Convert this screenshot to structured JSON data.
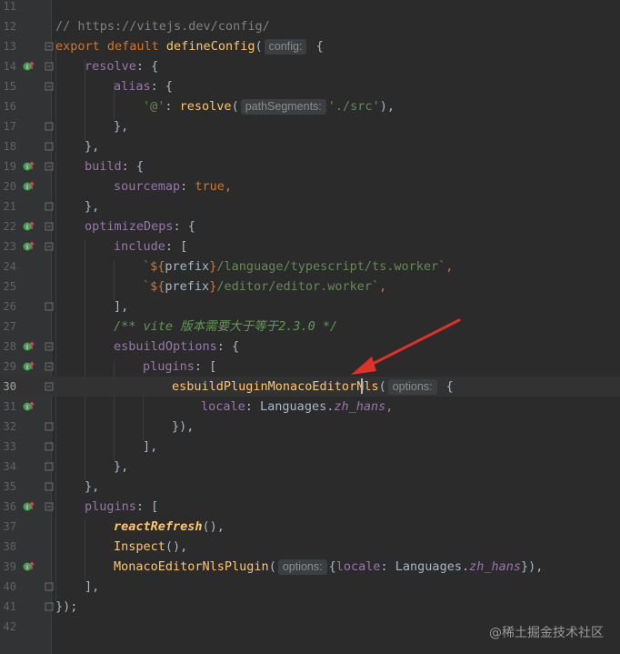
{
  "editor": {
    "line_numbers": [
      "11",
      "12",
      "13",
      "14",
      "15",
      "16",
      "17",
      "18",
      "19",
      "20",
      "21",
      "22",
      "23",
      "24",
      "25",
      "26",
      "27",
      "28",
      "29",
      "30",
      "31",
      "32",
      "33",
      "34",
      "35",
      "36",
      "37",
      "38",
      "39",
      "40",
      "41",
      "42"
    ],
    "current_line": "30",
    "hints": {
      "config": "config:",
      "path_segments": "pathSegments:",
      "options": "options:"
    },
    "code": {
      "l12_comment": "// https://vitejs.dev/config/",
      "l13_export": "export default ",
      "l13_fn": "defineConfig",
      "l13_open": "(",
      "l13_brace": " {",
      "l14_key": "resolve",
      "l14_rest": ": {",
      "l15_key": "alias",
      "l15_rest": ": {",
      "l16_key": "'@'",
      "l16_colon": ": ",
      "l16_fn": "resolve",
      "l16_open": "(",
      "l16_str": "'./src'",
      "l16_close": "),",
      "l17": "},",
      "l18": "},",
      "l19_key": "build",
      "l19_rest": ": {",
      "l20_key": "sourcemap",
      "l20_colon": ": ",
      "l20_val": "true",
      "l20_comma": ",",
      "l21": "},",
      "l22_key": "optimizeDeps",
      "l22_rest": ": {",
      "l23_key": "include",
      "l23_rest": ": [",
      "l24_tick": "`",
      "l24_dollar": "${",
      "l24_var": "prefix",
      "l24_close": "}",
      "l24_str": "/language/typescript/ts.worker`",
      "l24_comma": ",",
      "l25_tick": "`",
      "l25_dollar": "${",
      "l25_var": "prefix",
      "l25_close": "}",
      "l25_str": "/editor/editor.worker`",
      "l25_comma": ",",
      "l26": "],",
      "l27_comment": "/** vite 版本需要大于等于2.3.0 */",
      "l28_key": "esbuildOptions",
      "l28_rest": ": {",
      "l29_key": "plugins",
      "l29_rest": ": [",
      "l30_fn": "esbuildPluginMonacoEditorNls",
      "l30_open": "(",
      "l30_brace": " {",
      "l31_key": "locale",
      "l31_colon": ": ",
      "l31_obj": "Languages.",
      "l31_prop": "zh_hans",
      "l31_comma": ",",
      "l32": "}),",
      "l33": "],",
      "l34": "},",
      "l35": "},",
      "l36_key": "plugins",
      "l36_rest": ": [",
      "l37_fn": "reactRefresh",
      "l37_rest": "(),",
      "l38_fn": "Inspect",
      "l38_rest": "(),",
      "l39_fn": "MonacoEditorNlsPlugin",
      "l39_open": "(",
      "l39_brace": "{",
      "l39_key": "locale",
      "l39_colon": ": ",
      "l39_obj": "Languages.",
      "l39_prop": "zh_hans",
      "l39_close": "}),",
      "l40": "],",
      "l41": "});"
    },
    "gutter_markers": [
      "14",
      "19",
      "20",
      "22",
      "23",
      "28",
      "29",
      "31",
      "36",
      "39"
    ]
  },
  "watermark": "@稀土掘金技术社区",
  "colors": {
    "background": "#2b2b2b",
    "keyword": "#cc7832",
    "function": "#ffc66d",
    "property": "#9876aa",
    "string": "#6a8759",
    "annotation_arrow": "#e0302a"
  }
}
